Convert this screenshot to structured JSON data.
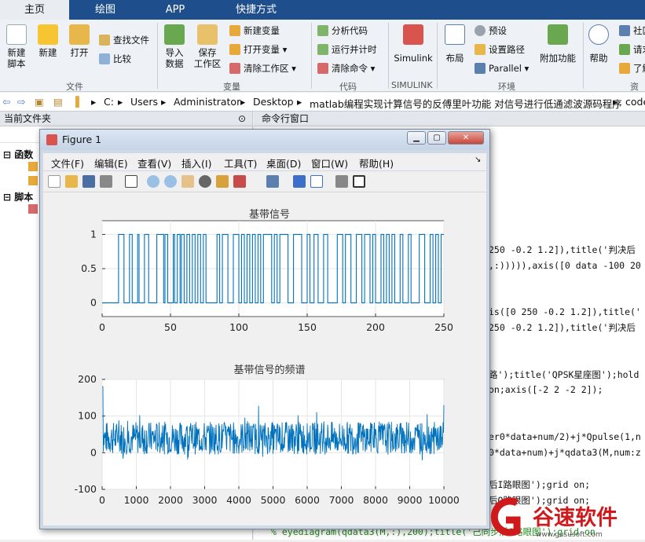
{
  "tabs": [
    "主页",
    "绘图",
    "APP",
    "快捷方式"
  ],
  "ribbon": {
    "file": {
      "new_script": "新建\n脚本",
      "new": "新建",
      "open": "打开",
      "find_files": "查找文件",
      "compare": "比较",
      "group": "文件"
    },
    "variable": {
      "import": "导入\n数据",
      "save_ws": "保存\n工作区",
      "new_var": "新建变量",
      "open_var": "打开变量",
      "clear_ws": "清除工作区",
      "group": "变量"
    },
    "code": {
      "analyze": "分析代码",
      "run_time": "运行并计时",
      "clear_cmd": "清除命令",
      "group": "代码"
    },
    "simulink": {
      "label": "Simulink",
      "group": "SIMULINK"
    },
    "env": {
      "layout": "布局",
      "prefs": "预设",
      "set_path": "设置路径",
      "parallel": "Parallel",
      "addons": "附加功能",
      "group": "环境"
    },
    "resources": {
      "help": "帮助",
      "community": "社区",
      "request": "请求",
      "learn": "了解",
      "group": "资源"
    }
  },
  "address": [
    "C:",
    "Users",
    "Administrator",
    "Desktop",
    "matlab编程实现计算信号的反傅里叶功能 对信号进行低通滤波源码程序",
    "code"
  ],
  "left_panel": {
    "title": "当前文件夹",
    "sections": [
      "函数",
      "脚本"
    ]
  },
  "command_window": {
    "title": "命令行窗口",
    "lines": [
      "250 -0.2 1.2]),title('判决后",
      ",:))))),axis([0 data -100 20",
      "is([0 250 -0.2 1.2]),title('",
      "250 -0.2 1.2]),title('判决后",
      "路');title('QPSK星座图');hold",
      " on;axis([-2 2 -2 2]);",
      "er0*data+num/2)+j*Qpulse(1,n",
      "0*data+num)+j*qdata3(M,num:z",
      "后I路眼图');grid on;",
      "后Q路眼图');grid on;",
      "% eyediagram(qdata3(M,:),200);title('己同步后Q路眼图');grid on"
    ]
  },
  "figure": {
    "title": "Figure 1",
    "menus": [
      "文件(F)",
      "编辑(E)",
      "查看(V)",
      "插入(I)",
      "工具(T)",
      "桌面(D)",
      "窗口(W)",
      "帮助(H)"
    ]
  },
  "chart_data": [
    {
      "type": "line",
      "title": "基带信号",
      "xlim": [
        0,
        250
      ],
      "ylim": [
        0,
        1
      ],
      "xticks": [
        0,
        50,
        100,
        150,
        200,
        250
      ],
      "yticks": [
        0,
        0.5,
        1
      ],
      "color": "#0072bd",
      "transitions": [
        12,
        16,
        20,
        22,
        26,
        27,
        31,
        34,
        40,
        45,
        46,
        48,
        52,
        53,
        55,
        57,
        58,
        60,
        62,
        64,
        66,
        68,
        70,
        72,
        74,
        76,
        84,
        86,
        88,
        92,
        96,
        100,
        102,
        104,
        106,
        108,
        110,
        112,
        114,
        116,
        118,
        124,
        126,
        128,
        130,
        136,
        140,
        146,
        150,
        152,
        155,
        158,
        162,
        165,
        172,
        176,
        178,
        182,
        186,
        190,
        192,
        196,
        198,
        200,
        204,
        206,
        208,
        210,
        212,
        214,
        218,
        220,
        224,
        226,
        232,
        236,
        240,
        242,
        244,
        246,
        248
      ],
      "start_value": 0
    },
    {
      "type": "line",
      "title": "基带信号的频谱",
      "xlim": [
        0,
        10000
      ],
      "ylim": [
        -100,
        200
      ],
      "xticks": [
        0,
        1000,
        2000,
        3000,
        4000,
        5000,
        6000,
        7000,
        8000,
        9000,
        10000
      ],
      "yticks": [
        -100,
        0,
        100,
        200
      ],
      "color": "#0072bd",
      "baseline": 40,
      "noise_amplitude": 45
    }
  ],
  "watermark": "谷速软件",
  "watermark_url": "www.gususoft.com"
}
